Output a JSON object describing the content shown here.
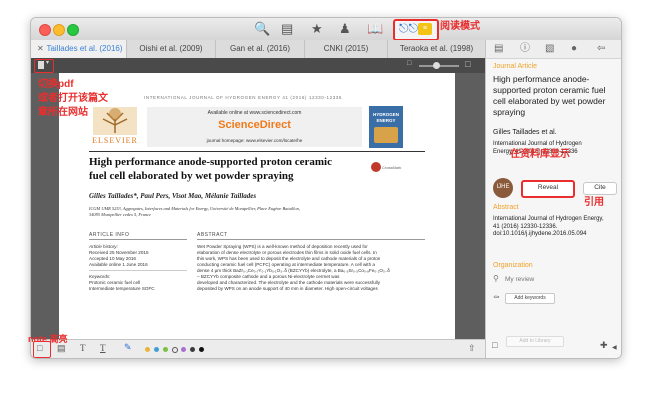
{
  "annotations": {
    "reading_mode": "阅读模式",
    "switch_pdf_line1": "切换pdf",
    "switch_pdf_line2": "或者打开该篇文",
    "switch_pdf_line3": "章所在网站",
    "library_display": "在资料库显示",
    "cite": "引用",
    "note_highlight": "note 高亮"
  },
  "toolbar": {
    "icons": [
      "search-icon",
      "library-icon",
      "star-icon",
      "person-icon",
      "book-icon",
      "glasses-icon"
    ],
    "read_badge": "≡"
  },
  "tabs": [
    {
      "label": "Taillades et al. (2016)",
      "active": true
    },
    {
      "label": "Oishi et al. (2009)",
      "active": false
    },
    {
      "label": "Gan et al. (2016)",
      "active": false
    },
    {
      "label": "CNKI (2015)",
      "active": false
    },
    {
      "label": "Teraoka et al. (1998)",
      "active": false
    }
  ],
  "paper": {
    "journal_header": "INTERNATIONAL JOURNAL OF HYDROGEN ENERGY 41 (2016) 12330-12336",
    "available_online": "Available online at www.sciencedirect.com",
    "sciencedirect": "ScienceDirect",
    "journal_homepage": "journal homepage: www.elsevier.com/locate/he",
    "elsevier": "ELSEVIER",
    "cover_line1": "HYDROGEN",
    "cover_line2": "ENERGY",
    "crossmark": "CrossMark",
    "title_line1": "High performance anode-supported proton ceramic",
    "title_line2": "fuel cell elaborated by wet powder spraying",
    "authors": "Gilles Taillades*, Paul Pers, Visot Mao, Mélanie Taillades",
    "affil_line1": "ICGM UMR 5253, Aggregates, Interfaces and Materials for Energy, Université de Montpellier, Place Eugène Bataillon,",
    "affil_line2": "34095 Montpellier cedex 5, France",
    "article_info": "ARTICLE INFO",
    "abstract_head": "ABSTRACT",
    "history": [
      "Article history:",
      "Received 25 November 2015",
      "Accepted 10 May 2016",
      "Available online 1 June 2016"
    ],
    "keywords": [
      "Keywords:",
      "Protonic ceramic fuel cell",
      "Intermediate temperature SOFC"
    ],
    "abstract_lines": [
      "Wet Powder Spraying (WPS) is a well-known method of deposition recently used for",
      "elaboration of dense electrolyte or porous electrodes thin films in solid oxide fuel cells. In",
      "this work, WPS has been used to deposit the electrolyte and cathode materials of a proton",
      "conducting ceramic fuel cell (PCFC) operating at intermediate temperature. A cell with a",
      "dense 4 µm thick BaZr₀.₁Ce₀.₇Y₀.₁Yb₀.₁O₃₋δ (BZCYYb) electrolyte, a Ba₀.₅Sr₀.₅Co₀.₈Fe₀.₂O₃₋δ",
      "– BZCYYb composite cathode and a porous Ni-electrolyte cermet was",
      "developed and characterized. The electrolyte and the cathode materials were successfully",
      "deposited by WPS on an anode support of 40 mm in diameter. High open-circuit voltages"
    ]
  },
  "sidebar": {
    "type_label": "Journal Article",
    "title": "High performance anode-supported proton ceramic fuel cell elaborated by wet powder spraying",
    "authors": "Gilles Taillades et al.",
    "citation": "International Journal of Hydrogen Energy, 41 (2016) 12330-12336",
    "avatar_initials": "IJHE",
    "reveal_label": "Reveal",
    "cite_label": "Cite",
    "abstract_label": "Abstract",
    "abstract_text": "International Journal of Hydrogen Energy, 41 (2016) 12330-12336. doi:10.1016/j.ijhydene.2016.05.094",
    "organization_label": "Organization",
    "my_review": "My review",
    "add_keywords": "Add keywords",
    "add_to_library": "Add to Library"
  },
  "bottombar": {
    "tools": [
      "note-icon",
      "highlight-icon",
      "text-icon",
      "text-color-icon",
      "pen-icon"
    ],
    "colors": [
      "#e9b43a",
      "#3fa0d8",
      "#7ac143",
      "#777777",
      "#a86fd0",
      "#3b3b3b",
      "#111111"
    ]
  }
}
